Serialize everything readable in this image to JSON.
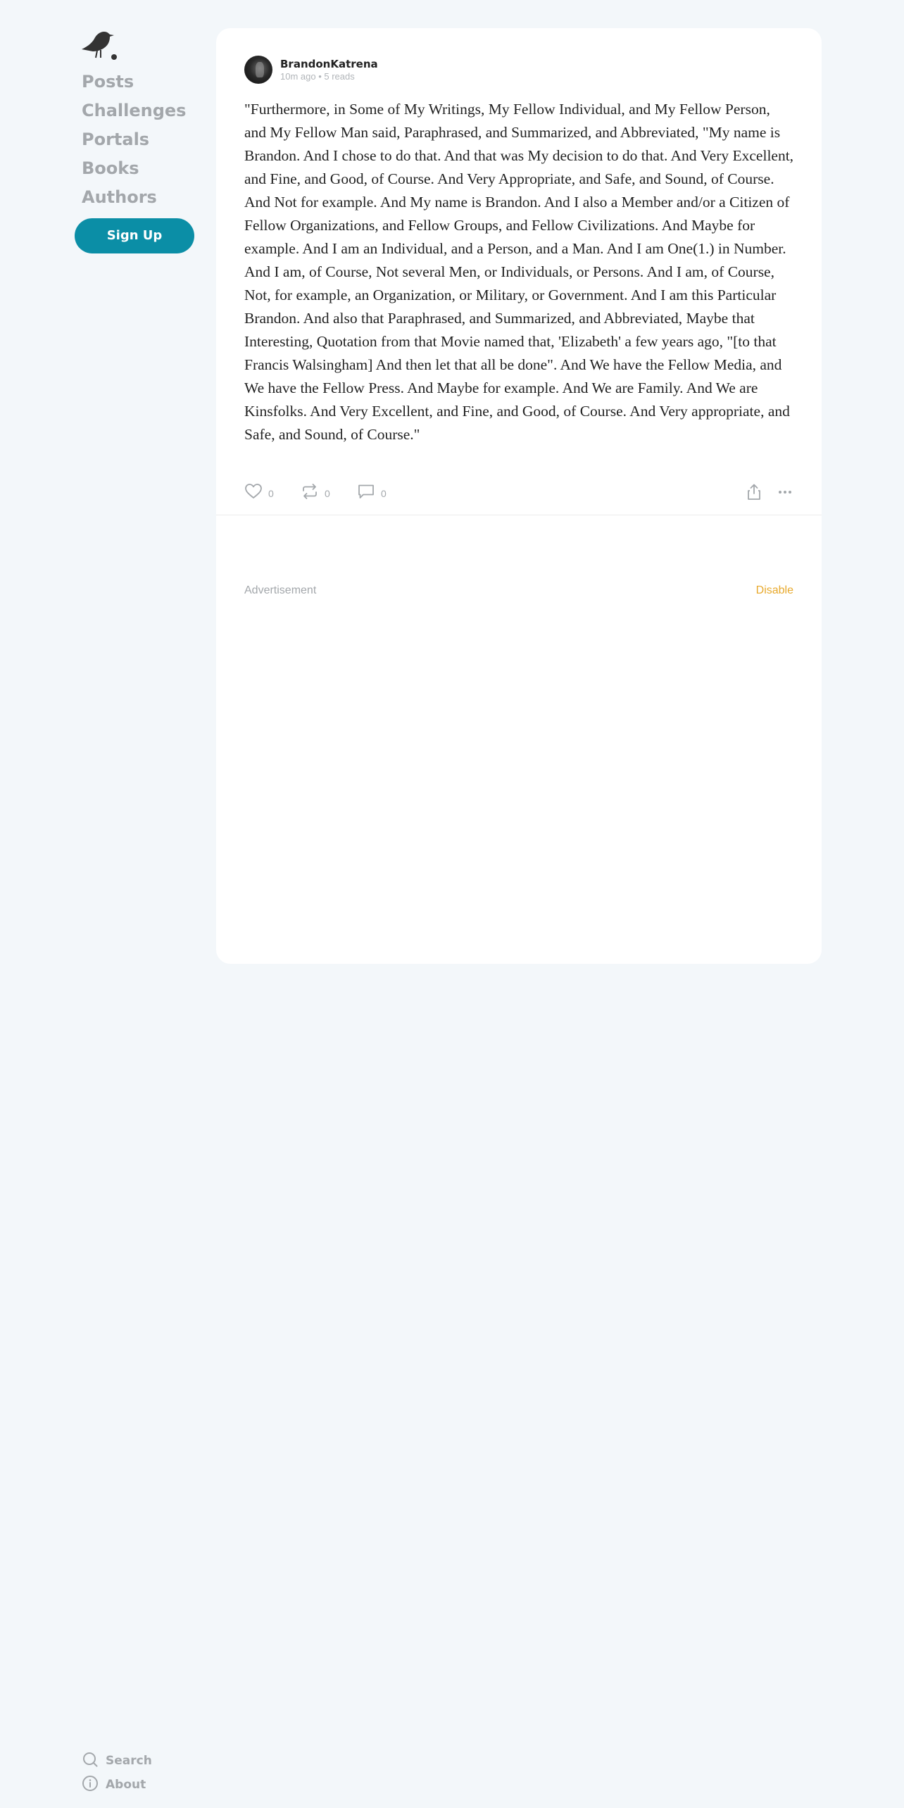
{
  "sidebar": {
    "logo": "crow-logo-icon",
    "nav": [
      "Posts",
      "Challenges",
      "Portals",
      "Books",
      "Authors"
    ],
    "signup_label": "Sign Up",
    "bottom": [
      {
        "label": "Search",
        "icon": "search-icon"
      },
      {
        "label": "About",
        "icon": "info-icon"
      }
    ]
  },
  "post": {
    "author": "BrandonKatrena",
    "time": "10m ago",
    "separator": " • ",
    "reads": "5 reads",
    "body": "\"Furthermore, in Some of My Writings, My Fellow Individual, and My Fellow Person, and My Fellow Man said, Paraphrased, and Summarized, and Abbreviated, \"My name is Brandon. And I chose to do that. And that was My decision to do that. And Very Excellent, and Fine, and Good, of Course. And Very Appropriate, and Safe, and Sound, of Course. And Not for example. And My name is Brandon. And I also a Member and/or a Citizen of Fellow Organizations, and Fellow Groups, and Fellow Civilizations. And Maybe for example. And I am an Individual, and a Person, and a Man. And I am One(1.) in Number. And I am, of Course, Not several Men, or Individuals, or Persons. And I am, of Course, Not, for example, an Organization, or Military, or Government. And I am this Particular Brandon. And also that Paraphrased, and Summarized, and Abbreviated, Maybe that Interesting, Quotation from that Movie named that, 'Elizabeth' a few years ago, \"[to that Francis Walsingham] And then let that all be done\". And We have the Fellow Media, and We have the Fellow Press. And Maybe for example. And We are Family. And We are Kinsfolks. And Very Excellent, and Fine, and Good, of Course. And Very appropriate, and Safe, and Sound, of Course.\"",
    "likes": "0",
    "reposts": "0",
    "comments": "0"
  },
  "ad": {
    "label": "Advertisement",
    "disable_label": "Disable"
  },
  "colors": {
    "background": "#f3f7fa",
    "signup": "#0b8ea6",
    "disable": "#e8a92c",
    "nav": "#a3a7ab"
  }
}
